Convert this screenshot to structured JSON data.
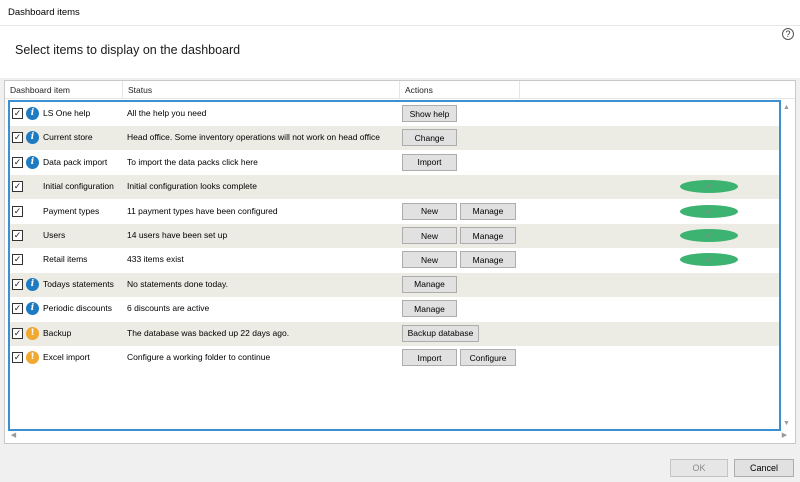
{
  "window": {
    "title": "Dashboard items"
  },
  "header": {
    "heading": "Select items to display on the dashboard",
    "help_glyph": "?"
  },
  "columns": [
    "Dashboard item",
    "Status",
    "Actions"
  ],
  "rows": [
    {
      "checked": true,
      "icon": "info-icon",
      "name": "LS One help",
      "status": "All the help you need",
      "actions": [
        "Show help"
      ]
    },
    {
      "checked": true,
      "icon": "info-icon",
      "name": "Current store",
      "status": "Head office. Some inventory operations will not work on head office",
      "actions": [
        "Change"
      ]
    },
    {
      "checked": true,
      "icon": "info-icon",
      "name": "Data pack import",
      "status": "To import the data packs click here",
      "actions": [
        "Import"
      ]
    },
    {
      "checked": true,
      "icon": "check-circle-icon",
      "name": "Initial configuration",
      "status": "Initial configuration looks complete",
      "actions": []
    },
    {
      "checked": true,
      "icon": "check-circle-icon",
      "name": "Payment types",
      "status": "11 payment types have been configured",
      "actions": [
        "New",
        "Manage"
      ]
    },
    {
      "checked": true,
      "icon": "check-circle-icon",
      "name": "Users",
      "status": "14 users have been set up",
      "actions": [
        "New",
        "Manage"
      ]
    },
    {
      "checked": true,
      "icon": "check-circle-icon",
      "name": "Retail items",
      "status": "433 items exist",
      "actions": [
        "New",
        "Manage"
      ]
    },
    {
      "checked": true,
      "icon": "info-icon",
      "name": "Todays statements",
      "status": "No statements done today.",
      "actions": [
        "Manage"
      ]
    },
    {
      "checked": true,
      "icon": "info-icon",
      "name": "Periodic discounts",
      "status": "6 discounts are active",
      "actions": [
        "Manage"
      ]
    },
    {
      "checked": true,
      "icon": "warning-icon",
      "name": "Backup",
      "status": "The database was backed up 22 days ago.",
      "actions": [
        "Backup database"
      ]
    },
    {
      "checked": true,
      "icon": "warning-icon",
      "name": "Excel import",
      "status": "Configure a working folder to continue",
      "actions": [
        "Import",
        "Configure"
      ]
    }
  ],
  "footer": {
    "ok_label": "OK",
    "cancel_label": "Cancel"
  },
  "colors": {
    "accent": "#3c8fd0",
    "info": "#1f7bc1",
    "ok": "#3cb371",
    "warn": "#f0a830",
    "alt_row": "#ecece4"
  }
}
